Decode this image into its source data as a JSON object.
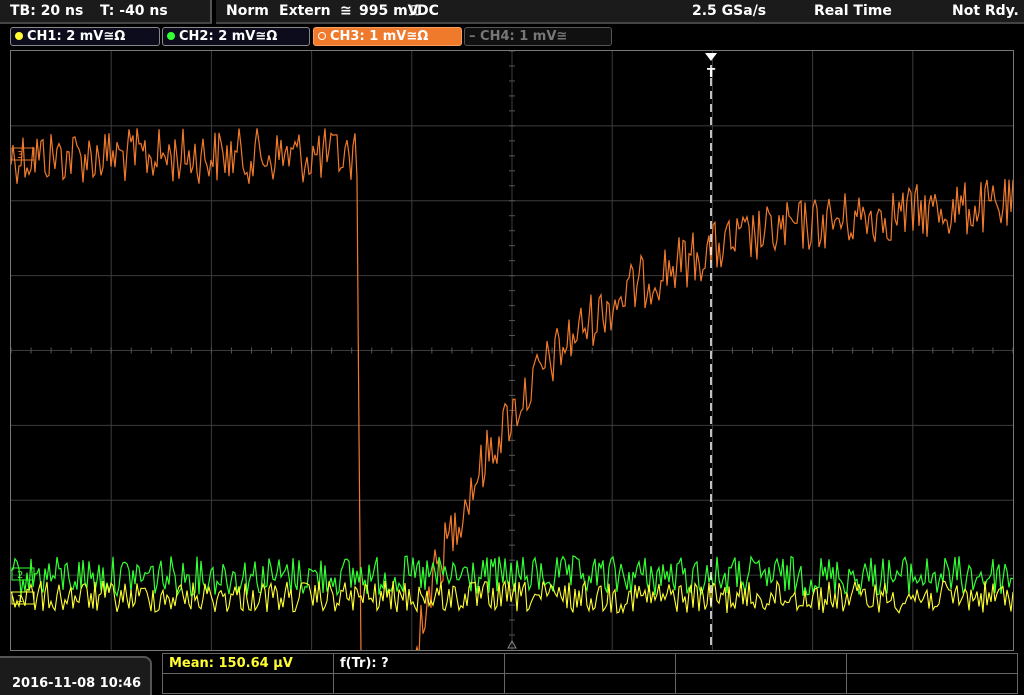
{
  "status": {
    "timebase": "TB: 20 ns",
    "trigger_time": "T: -40 ns",
    "mode": "Norm",
    "trigger_source": "Extern",
    "trigger_level": "995 mV",
    "coupling": "DC",
    "sample_rate": "2.5 GSa/s",
    "acquisition": "Real Time",
    "ready_state": "Not Rdy."
  },
  "channels": [
    {
      "label": "CH1: 2 mV",
      "color": "#ffff33",
      "state": "on"
    },
    {
      "label": "CH2: 2 mV",
      "color": "#33ff33",
      "state": "on"
    },
    {
      "label": "CH3: 1 mV",
      "color": "#f07a2c",
      "state": "active"
    },
    {
      "label": "CH4: 1 mV",
      "color": "#777777",
      "state": "off"
    }
  ],
  "markers": {
    "trigger": "T",
    "ch1": "1",
    "ch2": "2",
    "ch3": "3"
  },
  "datetime": "2016-11-08 10:46",
  "measurements": {
    "mean": "Mean: 150.64 µV",
    "rise_time": "f(Tr): ?"
  },
  "colors": {
    "ch1": "#ffff33",
    "ch2": "#33ff33",
    "ch3": "#f07a2c",
    "grid": "#3c3c3c"
  }
}
